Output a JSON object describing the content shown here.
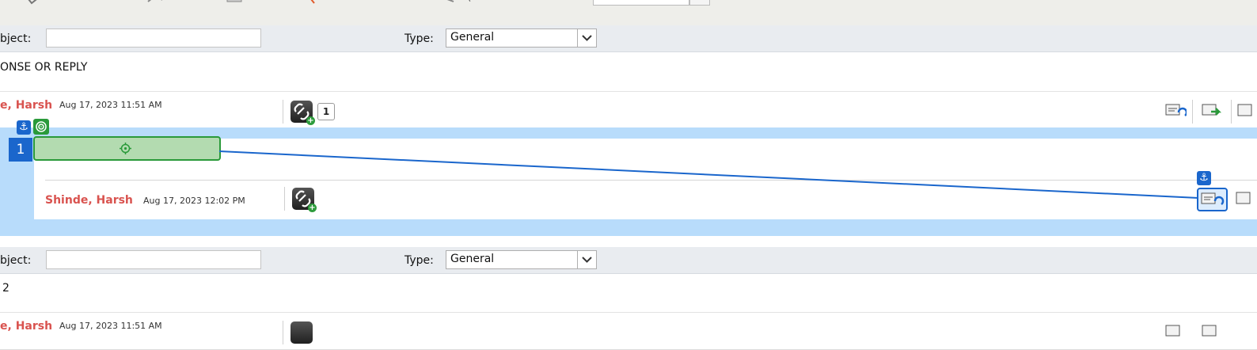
{
  "toolbar": {
    "icons": [
      "toolbar-tool-icon",
      "toolbar-tool-icon",
      "toolbar-tool-icon",
      "toolbar-tool-icon",
      "toolbar-tool-icon"
    ],
    "partial_text": "("
  },
  "composer_top": {
    "subject_label": "bject:",
    "subject_value": "",
    "type_label": "Type:",
    "type_value": "General"
  },
  "message1": {
    "body": "ONSE OR REPLY",
    "author": "e, Harsh",
    "date": "Aug 17, 2023 11:51 AM",
    "link_count": "1"
  },
  "reply": {
    "anchor_icon": "anchor-icon",
    "target_icon": "target-icon",
    "number": "1",
    "author": "Shinde, Harsh",
    "date": "Aug 17, 2023 12:02 PM"
  },
  "composer_bottom": {
    "subject_label": "bject:",
    "subject_value": "",
    "type_label": "Type:",
    "type_value": "General"
  },
  "message2": {
    "body": "2",
    "author": "e, Harsh",
    "date": "Aug 17, 2023 11:51 AM"
  },
  "colors": {
    "accent_blue": "#1a66cc",
    "author_red": "#d9534f",
    "success_green": "#2a9a3a",
    "reply_bg": "#b8dcfb"
  }
}
